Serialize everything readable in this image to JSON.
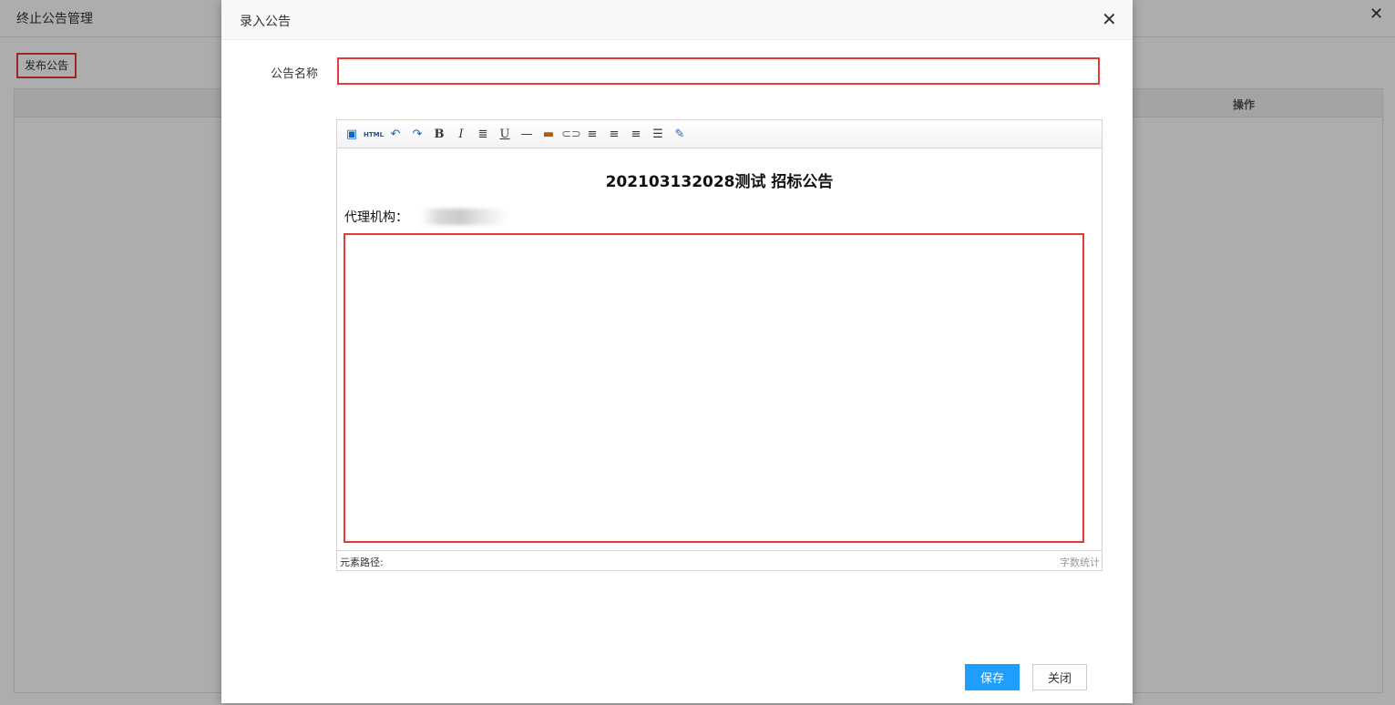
{
  "background": {
    "title": "终止公告管理",
    "publish_button": "发布公告",
    "table": {
      "columns": [
        "操作"
      ]
    }
  },
  "dialog": {
    "title": "录入公告",
    "form": {
      "name_label": "公告名称",
      "name_value": "",
      "name_placeholder": ""
    },
    "editor": {
      "toolbar_icons": [
        "source-screen-icon",
        "html-icon",
        "undo-icon",
        "redo-icon",
        "bold-icon",
        "italic-icon",
        "indent-icon",
        "underline-icon",
        "horizontal-rule-icon",
        "image-icon",
        "link-icon",
        "align-left-icon",
        "align-right-icon",
        "align-center-icon",
        "justify-icon",
        "attachment-icon"
      ],
      "content": {
        "heading": "202103132028测试 招标公告",
        "agency_label": "代理机构："
      },
      "status": {
        "element_path": "元素路径:",
        "word_count": "字数统计"
      }
    },
    "buttons": {
      "save": "保存",
      "close": "关闭"
    }
  },
  "colors": {
    "highlight": "#e53935",
    "primary": "#1e9fff"
  }
}
